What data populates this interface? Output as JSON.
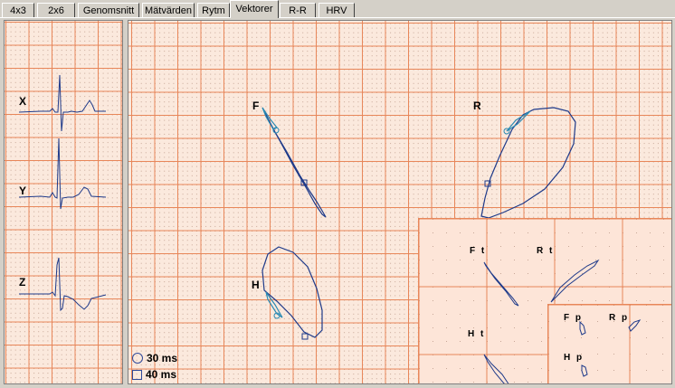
{
  "tabs": [
    {
      "label": "4x3",
      "active": false
    },
    {
      "label": "2x6",
      "active": false
    },
    {
      "label": "Genomsnitt",
      "active": false
    },
    {
      "label": "Mätvärden",
      "active": false
    },
    {
      "label": "Rytm",
      "active": false
    },
    {
      "label": "Vektorer",
      "active": true
    },
    {
      "label": "R-R",
      "active": false
    },
    {
      "label": "HRV",
      "active": false
    }
  ],
  "leads": {
    "x": "X",
    "y": "Y",
    "z": "Z"
  },
  "loops": {
    "frontal": "F",
    "right": "R",
    "horizontal": "H"
  },
  "legend": {
    "circle": "30 ms",
    "square": "40 ms"
  },
  "inset": {
    "ft": "F t",
    "rt": "R t",
    "ht": "H t",
    "fp": "F p",
    "rp": "R p",
    "hp": "H p"
  },
  "colors": {
    "grid_major": "#e8875a",
    "grid_dot": "#c8a898",
    "trace": "#1e3a8a",
    "panel_bg": "#fbe9dd",
    "inset_bg": "#fde5d8"
  }
}
